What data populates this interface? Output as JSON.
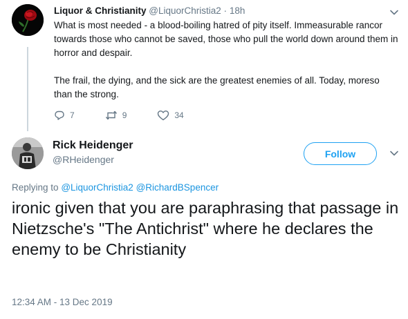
{
  "parent_tweet": {
    "display_name": "Liquor & Christianity",
    "handle": "@LiquorChristia2",
    "separator": "·",
    "age": "18h",
    "paragraph_1": "What is most needed - a blood-boiling hatred of pity itself. Immeasurable rancor towards those who cannot be saved, those who pull the world down around them in horror and despair.",
    "paragraph_2": "The frail, the dying, and the sick are the greatest enemies of all. Today, moreso than the strong.",
    "reply_count": "7",
    "retweet_count": "9",
    "like_count": "34",
    "icons": [
      "rose-avatar",
      "chevron-down-icon",
      "reply-icon",
      "retweet-icon",
      "heart-icon"
    ]
  },
  "main_tweet": {
    "display_name": "Rick Heidenger",
    "handle": "@RHeidenger",
    "follow_label": "Follow",
    "replying_prefix": "Replying to",
    "reply_mentions": [
      "@LiquorChristia2",
      "@RichardBSpencer"
    ],
    "text": "ironic given that you are paraphrasing that passage in Nietzsche's \"The Antichrist\" where he declares the enemy to be Christianity",
    "timestamp": "12:34 AM - 13 Dec 2019",
    "accent_color": "#1da1f2",
    "muted_color": "#657786"
  }
}
